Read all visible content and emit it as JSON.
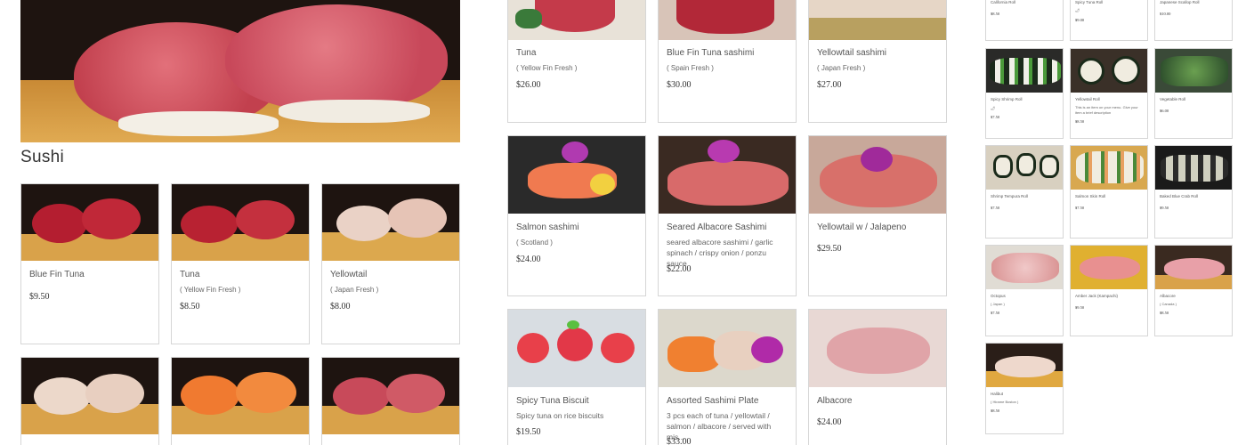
{
  "colors": {
    "border": "#d6d6d6",
    "board": "#d9a24a",
    "dark_bg": "#2a1b14",
    "tuna": "#b8202f",
    "yellowtail": "#e8c6b8",
    "salmon": "#ee7a3a"
  },
  "section": {
    "title": "Sushi"
  },
  "hero": {
    "icon": "sushi-hero-photo"
  },
  "sushi_items": [
    {
      "name": "Blue Fin Tuna",
      "origin": "",
      "price": "$9.50"
    },
    {
      "name": "Tuna",
      "origin": "( Yellow Fin Fresh )",
      "price": "$8.50"
    },
    {
      "name": "Yellowtail",
      "origin": "( Japan Fresh )",
      "price": "$8.00"
    },
    {
      "name": "",
      "origin": "",
      "price": ""
    },
    {
      "name": "",
      "origin": "",
      "price": ""
    },
    {
      "name": "",
      "origin": "",
      "price": ""
    }
  ],
  "sashimi_items": [
    {
      "name": "Tuna",
      "origin": "( Yellow Fin Fresh )",
      "description": "",
      "price": "$26.00"
    },
    {
      "name": "Blue Fin Tuna sashimi",
      "origin": "( Spain Fresh )",
      "description": "",
      "price": "$30.00"
    },
    {
      "name": "Yellowtail sashimi",
      "origin": "( Japan Fresh )",
      "description": "",
      "price": "$27.00"
    },
    {
      "name": "Salmon sashimi",
      "origin": "( Scotland )",
      "description": "",
      "price": "$24.00"
    },
    {
      "name": "Seared Albacore Sashimi",
      "origin": "",
      "description": "seared albacore sashimi / garlic spinach / crispy onion / ponzu sauce",
      "price": "$22.00"
    },
    {
      "name": "Yellowtail w / Jalapeno",
      "origin": "",
      "description": "",
      "price": "$29.50"
    },
    {
      "name": "Spicy Tuna Biscuit",
      "origin": "",
      "description": "Spicy tuna on rice biscuits",
      "price": "$19.50"
    },
    {
      "name": "Assorted Sashimi Plate",
      "origin": "",
      "description": "3 pcs each of tuna / yellowtail / salmon / albacore / served with mis...",
      "price": "$33.00"
    },
    {
      "name": "Albacore",
      "origin": "",
      "description": "",
      "price": "$24.00"
    }
  ],
  "roll_items": [
    {
      "name": "California Roll",
      "origin": "",
      "description": "",
      "price": "$8.50"
    },
    {
      "name": "Spicy Tuna Roll",
      "origin": "🌶",
      "description": "",
      "price": "$9.00"
    },
    {
      "name": "Japanese Scallop Roll",
      "origin": "",
      "description": "",
      "price": "$10.00"
    },
    {
      "name": "Spicy Shrimp Roll",
      "origin": "🌶",
      "description": "",
      "price": "$7.50"
    },
    {
      "name": "Yellowtail Roll",
      "origin": "",
      "description": "This is an item on your menu. Give your item a brief description",
      "price": "$8.50"
    },
    {
      "name": "Vegetable Roll",
      "origin": "",
      "description": "",
      "price": "$6.00"
    },
    {
      "name": "Shrimp Tempura Roll",
      "origin": "",
      "description": "",
      "price": "$7.50"
    },
    {
      "name": "Salmon Skin Roll",
      "origin": "",
      "description": "",
      "price": "$7.50"
    },
    {
      "name": "Baked Blue Crab Roll",
      "origin": "",
      "description": "",
      "price": "$9.50"
    },
    {
      "name": "Octopus",
      "origin": "( Japan )",
      "description": "",
      "price": "$7.50"
    },
    {
      "name": "Amber Jack (Kampachi)",
      "origin": "",
      "description": "",
      "price": "$9.50"
    },
    {
      "name": "Albacore",
      "origin": "( Canada )",
      "description": "",
      "price": "$8.50"
    },
    {
      "name": "Halibut",
      "origin": "( Hirame Boston )",
      "description": "",
      "price": "$8.50"
    }
  ]
}
